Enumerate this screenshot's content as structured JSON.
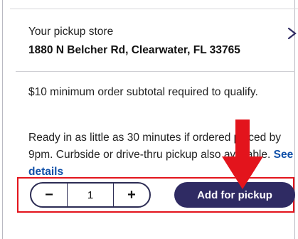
{
  "pickup_store": {
    "label": "Your pickup store",
    "address": "1880 N Belcher Rd, Clearwater, FL 33765",
    "close_icon": "chevron-right-icon"
  },
  "info": {
    "minimum_text": "$10 minimum order subtotal required to qualify.",
    "ready_text": "Ready in as little as 30 minutes if ordered placed by 9pm. Curbside or drive-thru pickup also available.",
    "see_details_label": "See details"
  },
  "quantity": {
    "decrement_label": "−",
    "value": "1",
    "increment_label": "+"
  },
  "add_button": {
    "label": "Add for pickup"
  },
  "colors": {
    "brand_navy": "#2f2b63",
    "link_blue": "#0f4fa8",
    "annotation_red": "#e3141c"
  }
}
